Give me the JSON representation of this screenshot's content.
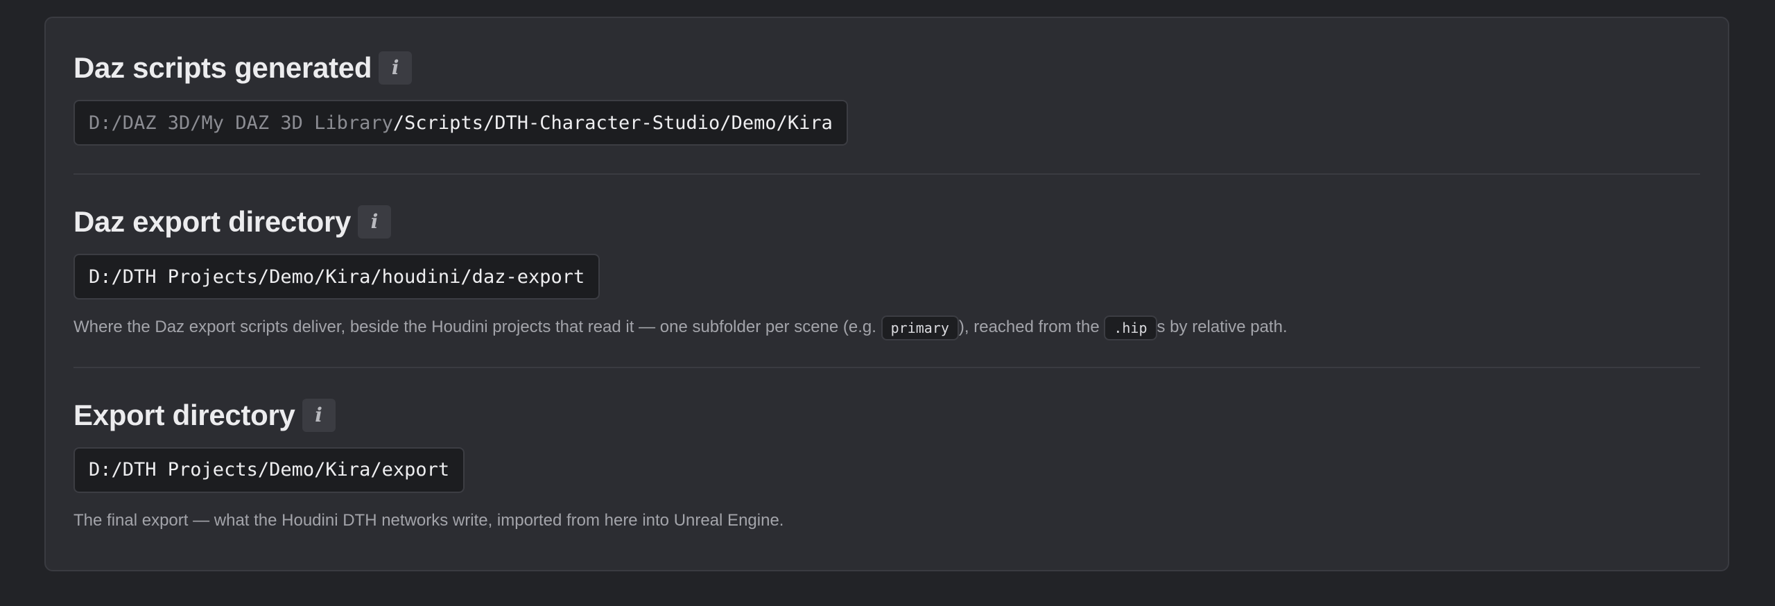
{
  "sections": [
    {
      "title": "Daz scripts generated",
      "info_icon": "info-icon",
      "path_prefix": "D:/DAZ 3D/My DAZ 3D Library",
      "path_suffix": "/Scripts/DTH-Character-Studio/Demo/Kira"
    },
    {
      "title": "Daz export directory",
      "info_icon": "info-icon",
      "path": "D:/DTH Projects/Demo/Kira/houdini/daz-export",
      "desc_part1": "Where the Daz export scripts deliver, beside the Houdini projects that read it — one subfolder per scene (e.g. ",
      "desc_code1": "primary",
      "desc_part2": "), reached from the ",
      "desc_code2": ".hip",
      "desc_part3": "s by relative path."
    },
    {
      "title": "Export directory",
      "info_icon": "info-icon",
      "path": "D:/DTH Projects/Demo/Kira/export",
      "desc": "The final export — what the Houdini DTH networks write, imported from here into Unreal Engine."
    }
  ],
  "info_glyph": "i",
  "colors": {
    "background": "#222327",
    "panel": "#2c2d32",
    "path_box": "#1c1d20",
    "muted_text": "#a3a4aa",
    "path_prefix": "#8c8d93"
  }
}
